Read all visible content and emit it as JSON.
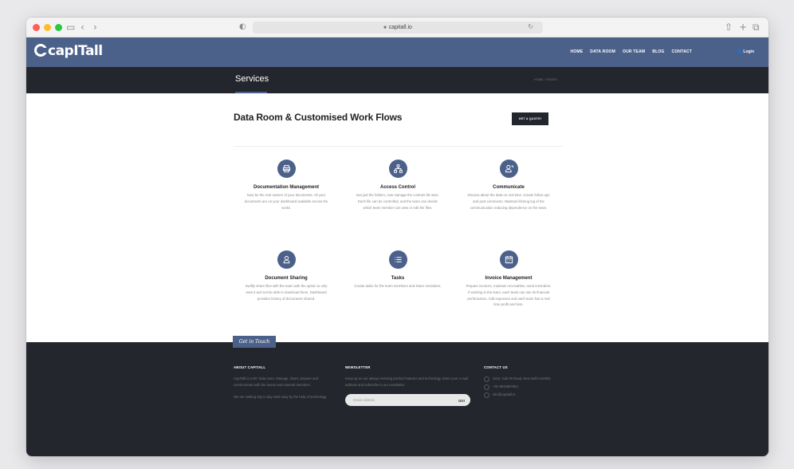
{
  "browser": {
    "url": "capitall.io",
    "lock_icon": "🔒"
  },
  "site": {
    "logo": "capITall",
    "nav": [
      "HOME",
      "DATA ROOM",
      "OUR TEAM",
      "BLOG",
      "CONTACT"
    ],
    "login": "Login"
  },
  "title_bar": {
    "title": "Services",
    "breadcrumb": "HOME / PAGES"
  },
  "main": {
    "heading": "Data Room & Customised Work Flows",
    "quote_button": "GET A QUOTE!",
    "services": [
      {
        "name": "Documentation Management",
        "icon": "printer-icon",
        "desc": "Now be the real owners of your documents. All your documents are on your dashboard available across the world."
      },
      {
        "name": "Access Control",
        "icon": "sitemap-icon",
        "desc": "Not just the folders, now manage the controls file wise. Each file can be controlled, and the team can decide which team member can view or edit the files."
      },
      {
        "name": "Communicate",
        "icon": "chat-user-icon",
        "desc": "Discuss about the data on real time. Create follow ups and post comments. Maintain lifelong log of the communication reducing dependence on the team."
      },
      {
        "name": "Document Sharing",
        "icon": "user-icon",
        "desc": "Swiftly share files with the team with the option to only view it and not be able to download them. Dashboard provides history of documents shared."
      },
      {
        "name": "Tasks",
        "icon": "list-icon",
        "desc": "Create tasks for the team members and share reminders."
      },
      {
        "name": "Invoice Management",
        "icon": "calendar-icon",
        "desc": "Prepare invoices, maintain receivables, send reminders. If working in the team, each team can see its financial performance. Add expenses and each team has a real time profit and loss."
      }
    ]
  },
  "footer": {
    "tag": "Get in Touch",
    "about": {
      "heading": "ABOUT CAPITALL",
      "p1": "CapITall is a DIY data room. Manage, share, prepare and communicate with the teams and external members.",
      "p2": "We are making day to day work easy by the help of technology."
    },
    "newsletter": {
      "heading": "NEWSLETTER",
      "text": "Keep up on our always evolving product features and technology. Enter your e-mail address and subscribe to our newsletter.",
      "placeholder": "Email Address",
      "go": "GO!"
    },
    "contact": {
      "heading": "CONTACT US",
      "address": "3215, Gali #5 Road, New Delhi-110002",
      "phone": "+91-9810987654",
      "email": "info@capitall.io"
    }
  },
  "colors": {
    "accent": "#4c618a",
    "dark": "#23272d"
  }
}
